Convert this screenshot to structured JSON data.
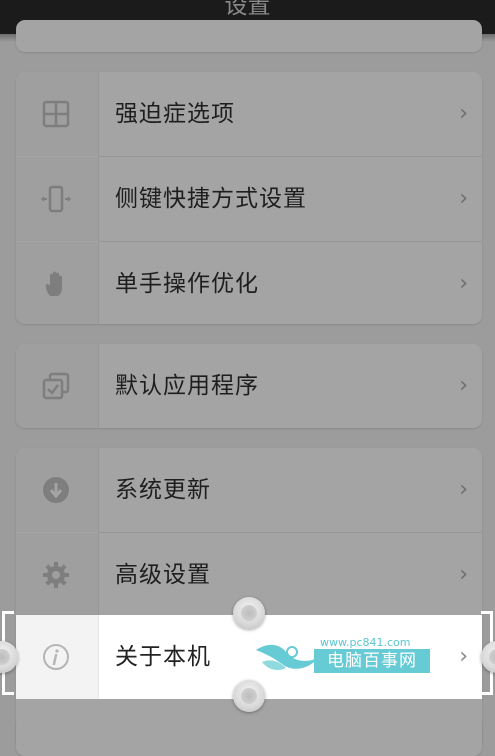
{
  "header": {
    "title": "设置"
  },
  "groups": [
    {
      "items": [
        {
          "label": "强迫症选项",
          "icon": "grid-icon"
        },
        {
          "label": "侧键快捷方式设置",
          "icon": "phone-side-keys-icon"
        },
        {
          "label": "单手操作优化",
          "icon": "hand-icon"
        }
      ]
    },
    {
      "items": [
        {
          "label": "默认应用程序",
          "icon": "default-apps-icon"
        }
      ]
    },
    {
      "items": [
        {
          "label": "系统更新",
          "icon": "download-icon"
        },
        {
          "label": "高级设置",
          "icon": "gear-icon"
        },
        {
          "label": "关于本机",
          "icon": "info-icon",
          "selected": true
        }
      ]
    }
  ],
  "chevron": "›",
  "watermark": {
    "url": "www.pc841.com",
    "name": "电脑百事网",
    "color": "#66cbd4"
  },
  "colors": {
    "overlay": "#9c9c9c",
    "titlebar": "#1b1b1b",
    "selected_row": "#ffffff"
  }
}
